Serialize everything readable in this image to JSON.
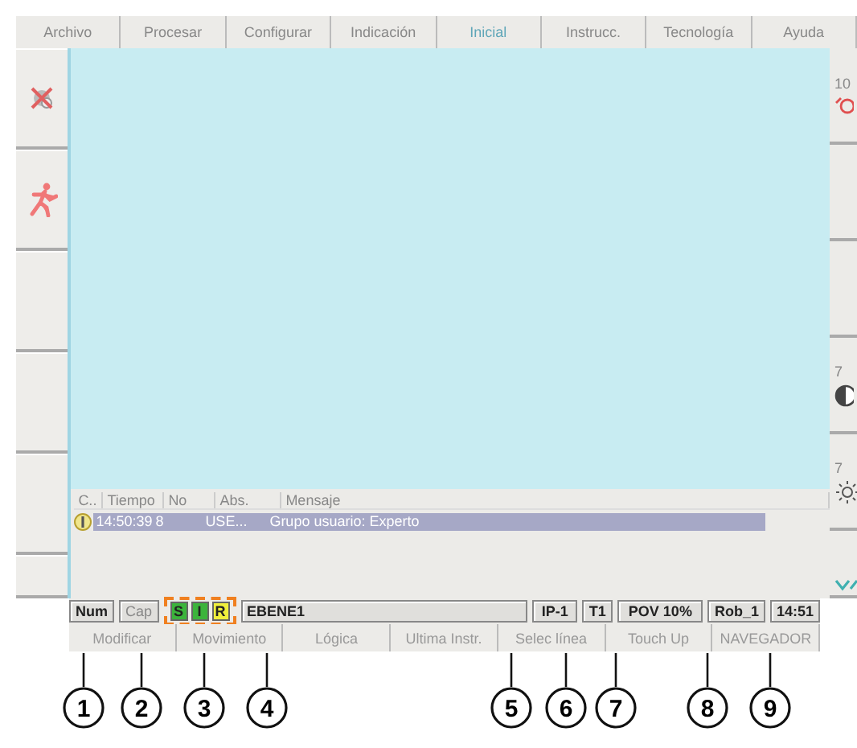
{
  "menu": [
    {
      "label": "Archivo",
      "disabled": false
    },
    {
      "label": "Procesar",
      "disabled": false
    },
    {
      "label": "Configurar",
      "disabled": false
    },
    {
      "label": "Indicación",
      "disabled": false
    },
    {
      "label": "Inicial",
      "disabled": true
    },
    {
      "label": "Instrucc.",
      "disabled": false
    },
    {
      "label": "Tecnología",
      "disabled": false
    },
    {
      "label": "Ayuda",
      "disabled": false
    }
  ],
  "right_panel": {
    "labels": [
      "10",
      "7",
      "7"
    ]
  },
  "messages": {
    "columns": [
      "C..",
      "Tiempo",
      "No",
      "Abs.",
      "Mensaje"
    ],
    "rows": [
      {
        "time": "14:50:39",
        "no": "8",
        "abs": "USE...",
        "text": "Grupo usuario: Experto",
        "selected": true
      }
    ]
  },
  "status_bar": {
    "num": {
      "label": "Num",
      "on": true
    },
    "cap": {
      "label": "Cap",
      "on": false
    },
    "indicators": [
      {
        "label": "S",
        "color": "#3cb43c"
      },
      {
        "label": "I",
        "color": "#3cb43c"
      },
      {
        "label": "R",
        "color": "#f0f03c"
      }
    ],
    "program": "EBENE1",
    "ipo": "IP-1",
    "mode": "T1",
    "pov": "POV 10%",
    "robot": "Rob_1",
    "time": "14:51"
  },
  "softkeys": [
    "Modificar",
    "Movimiento",
    "Lógica",
    "Ultima Instr.",
    "Selec línea",
    "Touch Up",
    "NAVEGADOR"
  ],
  "callouts": [
    "1",
    "2",
    "3",
    "4",
    "5",
    "6",
    "7",
    "8",
    "9"
  ]
}
